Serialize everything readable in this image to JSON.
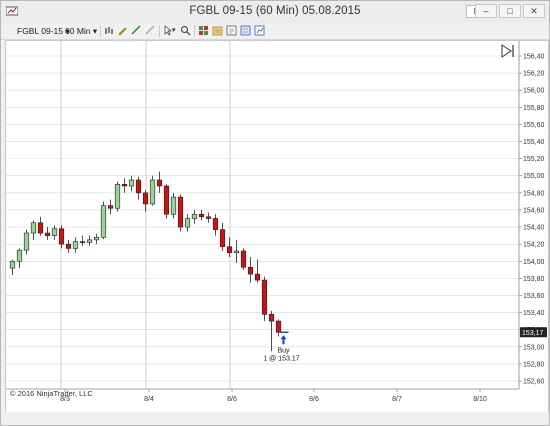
{
  "window": {
    "title": "FGBL 09-15 (60 Min)  05.08.2015",
    "link_button": "L",
    "minimize": "–",
    "maximize": "□",
    "close": "✕"
  },
  "toolbar": {
    "instrument": "FGBL 09-15",
    "interval": "60 Min",
    "icons": [
      "pencil-icon",
      "ruler-icon",
      "cursor-icon",
      "zoom-icon",
      "bar-chart-icon",
      "indicators-icon",
      "properties-icon",
      "data-box-icon",
      "chart-trader-icon"
    ]
  },
  "chart_data": {
    "type": "candlestick",
    "title": "",
    "ylim": [
      152.5,
      156.5
    ],
    "yticks": [
      152.6,
      152.8,
      153.0,
      153.2,
      153.4,
      153.6,
      153.8,
      154.0,
      154.2,
      154.4,
      154.6,
      154.8,
      155.0,
      155.2,
      155.4
    ],
    "ytick_labels": [
      "152,60",
      "152,80",
      "153,00",
      "153,20",
      "153,40",
      "153,60",
      "153,80",
      "154,00",
      "154,20",
      "154,40",
      "154,60",
      "154,80",
      "155,00",
      "155,20",
      "155,40",
      "155,60",
      "155,80",
      "156,00",
      "156,20",
      "156,40"
    ],
    "xtick_labels": [
      "8/3",
      "8/4",
      "8/6",
      "8/6",
      "8/7",
      "8/10"
    ],
    "last_price_label": "153,17",
    "colors": {
      "up": "#9ad29a",
      "down": "#c81414",
      "wick": "#222222",
      "grid": "#d8d8d8",
      "session": "#b0b0b0",
      "marker": "#1e3cc8"
    },
    "candles": [
      {
        "o": 153.92,
        "h": 154.02,
        "l": 153.84,
        "c": 154.0
      },
      {
        "o": 154.0,
        "h": 154.15,
        "l": 153.92,
        "c": 154.13
      },
      {
        "o": 154.13,
        "h": 154.37,
        "l": 154.08,
        "c": 154.33
      },
      {
        "o": 154.33,
        "h": 154.48,
        "l": 154.25,
        "c": 154.45
      },
      {
        "o": 154.45,
        "h": 154.52,
        "l": 154.3,
        "c": 154.33
      },
      {
        "o": 154.33,
        "h": 154.4,
        "l": 154.25,
        "c": 154.3
      },
      {
        "o": 154.3,
        "h": 154.42,
        "l": 154.25,
        "c": 154.38
      },
      {
        "o": 154.38,
        "h": 154.42,
        "l": 154.15,
        "c": 154.2
      },
      {
        "o": 154.2,
        "h": 154.25,
        "l": 154.1,
        "c": 154.15
      },
      {
        "o": 154.15,
        "h": 154.28,
        "l": 154.1,
        "c": 154.23
      },
      {
        "o": 154.23,
        "h": 154.3,
        "l": 154.18,
        "c": 154.22
      },
      {
        "o": 154.22,
        "h": 154.3,
        "l": 154.18,
        "c": 154.25
      },
      {
        "o": 154.25,
        "h": 154.32,
        "l": 154.2,
        "c": 154.28
      },
      {
        "o": 154.28,
        "h": 154.7,
        "l": 154.26,
        "c": 154.65
      },
      {
        "o": 154.65,
        "h": 154.72,
        "l": 154.55,
        "c": 154.62
      },
      {
        "o": 154.62,
        "h": 154.93,
        "l": 154.58,
        "c": 154.9
      },
      {
        "o": 154.9,
        "h": 154.97,
        "l": 154.8,
        "c": 154.88
      },
      {
        "o": 154.88,
        "h": 155.0,
        "l": 154.82,
        "c": 154.95
      },
      {
        "o": 154.95,
        "h": 154.99,
        "l": 154.72,
        "c": 154.8
      },
      {
        "o": 154.8,
        "h": 154.83,
        "l": 154.58,
        "c": 154.67
      },
      {
        "o": 154.67,
        "h": 155.0,
        "l": 154.65,
        "c": 154.95
      },
      {
        "o": 154.95,
        "h": 155.05,
        "l": 154.8,
        "c": 154.88
      },
      {
        "o": 154.88,
        "h": 154.9,
        "l": 154.5,
        "c": 154.55
      },
      {
        "o": 154.55,
        "h": 154.8,
        "l": 154.5,
        "c": 154.75
      },
      {
        "o": 154.75,
        "h": 154.78,
        "l": 154.35,
        "c": 154.4
      },
      {
        "o": 154.4,
        "h": 154.55,
        "l": 154.35,
        "c": 154.5
      },
      {
        "o": 154.5,
        "h": 154.6,
        "l": 154.44,
        "c": 154.55
      },
      {
        "o": 154.55,
        "h": 154.6,
        "l": 154.48,
        "c": 154.52
      },
      {
        "o": 154.52,
        "h": 154.57,
        "l": 154.45,
        "c": 154.5
      },
      {
        "o": 154.5,
        "h": 154.55,
        "l": 154.3,
        "c": 154.37
      },
      {
        "o": 154.37,
        "h": 154.45,
        "l": 154.12,
        "c": 154.17
      },
      {
        "o": 154.17,
        "h": 154.28,
        "l": 154.05,
        "c": 154.1
      },
      {
        "o": 154.1,
        "h": 154.25,
        "l": 153.98,
        "c": 154.12
      },
      {
        "o": 154.12,
        "h": 154.15,
        "l": 153.9,
        "c": 153.93
      },
      {
        "o": 153.93,
        "h": 154.05,
        "l": 153.75,
        "c": 153.85
      },
      {
        "o": 153.85,
        "h": 154.02,
        "l": 153.75,
        "c": 153.78
      },
      {
        "o": 153.78,
        "h": 153.82,
        "l": 153.3,
        "c": 153.38
      },
      {
        "o": 153.38,
        "h": 153.42,
        "l": 152.95,
        "c": 153.3
      },
      {
        "o": 153.3,
        "h": 153.32,
        "l": 153.12,
        "c": 153.17
      }
    ],
    "annotations": [
      {
        "type": "buy-marker",
        "label": "Buy",
        "sublabel": "1 @ 153,17",
        "price": 153.17
      }
    ]
  },
  "footer": {
    "copyright": "© 2016 NinjaTrader, LLC"
  }
}
